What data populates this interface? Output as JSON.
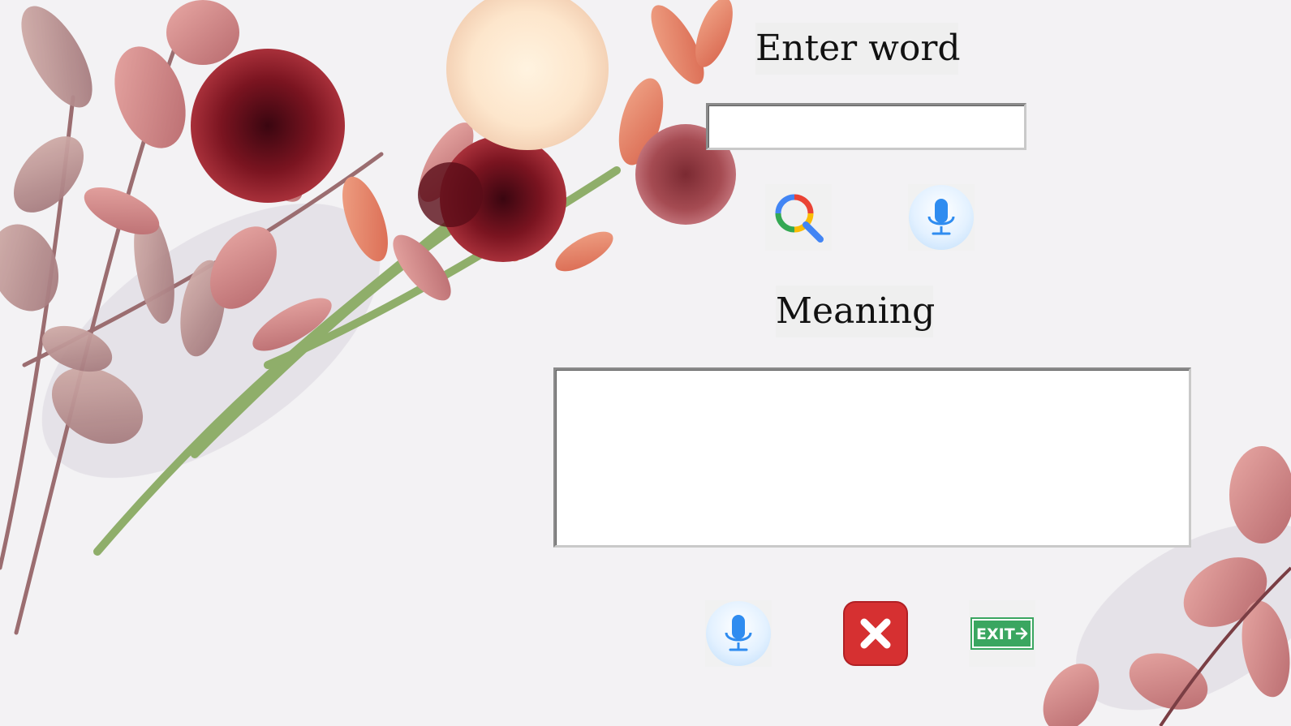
{
  "labels": {
    "enter_word": "Enter word",
    "meaning": "Meaning"
  },
  "inputs": {
    "word_value": "",
    "meaning_value": ""
  },
  "icons": {
    "search": "search-icon",
    "voice_search": "microphone-icon",
    "speak_meaning": "microphone-icon",
    "clear": "close-icon",
    "exit": "exit-sign-icon"
  },
  "exit_sign_text": "EXIT",
  "colors": {
    "background": "#f3f2f4",
    "label_bg": "#efefef",
    "field_border": "#8a8a8a",
    "mic_blue": "#2f8cf0",
    "clear_red": "#d63031",
    "exit_green": "#3aa660"
  }
}
